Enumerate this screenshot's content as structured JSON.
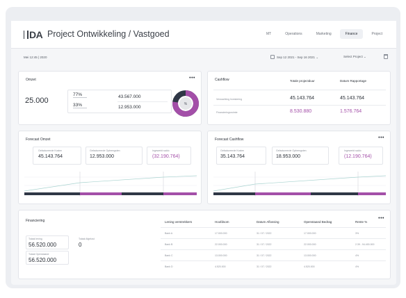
{
  "header": {
    "logo": "DA",
    "title": "Project Ontwikkeling / Vastgoed",
    "nav": [
      "MT",
      "Operations",
      "Marketing",
      "Finance",
      "Project"
    ],
    "active_nav": "Finance"
  },
  "subbar": {
    "date": "Mei 12:45 | 2020",
    "range": "Sep 12 2021 - Sep 16 2021",
    "select_project": "Select Project"
  },
  "omzet": {
    "title": "Omzet",
    "total": "25.000",
    "pct1": "77%",
    "pct2": "33%",
    "value1": "43.567.000",
    "value2": "12.953.000",
    "donut_center": "%",
    "donut_fraction": 0.77
  },
  "cashflow": {
    "title": "Cashflow",
    "columns": [
      "Totale projectduur",
      "Datum Rapportage"
    ],
    "rows": [
      {
        "label": "Verwachting Investering",
        "total": "45.143.764",
        "report": "45.143.764",
        "pink": false
      },
      {
        "label": "Financieringsruimte",
        "total": "8.530.880",
        "report": "1.576.764",
        "pink": true
      }
    ]
  },
  "forecast_omzet": {
    "title": "Forecast Omzet",
    "kpis": [
      {
        "label": "Gefactureerde Kosten",
        "value": "45.143.764"
      },
      {
        "label": "Gefactureerde Opbrengsten",
        "value": "12.953.000"
      },
      {
        "label": "Ingewerkt saldo",
        "value": "(32.190.764)"
      }
    ]
  },
  "forecast_cashflow": {
    "title": "Forecast Cashflow",
    "kpis": [
      {
        "label": "Gefactureerde Kosten",
        "value": "35.143.764"
      },
      {
        "label": "Gefactureerde Opbrengsten",
        "value": "18.953.000"
      },
      {
        "label": "Ingewerkt saldo",
        "value": "(12.190.764)"
      }
    ]
  },
  "financiering": {
    "title": "Financiering",
    "box1_label": "Totaal lening",
    "box1_value": "56.520.000",
    "box2_label": "Totaal Afgelost",
    "box2_value": "0",
    "box3_label": "Totaal Openstaand",
    "box3_value": "56.520.000",
    "columns": [
      "Lening verstrekkers",
      "Hoofdsom",
      "Datum Aflossing",
      "Openstaand Bedrag",
      "Rente %"
    ],
    "rows": [
      [
        "Bank A",
        "17.000.000",
        "31 / 07 / 2022",
        "17.000.000",
        "3%"
      ],
      [
        "Bank B",
        "22.000.000",
        "31 / 07 / 2022",
        "22.000.000",
        "2.39 - 94.400.000"
      ],
      [
        "Bank C",
        "13.000.000",
        "31 / 07 / 2022",
        "13.000.000",
        "4%"
      ],
      [
        "Bank D",
        "4.520.000",
        "31 / 07 / 2022",
        "4.520.000",
        "4%"
      ]
    ]
  },
  "colors": {
    "accent": "#a34fa8",
    "dark": "#2f3746",
    "teal": "#a9d3d0"
  }
}
